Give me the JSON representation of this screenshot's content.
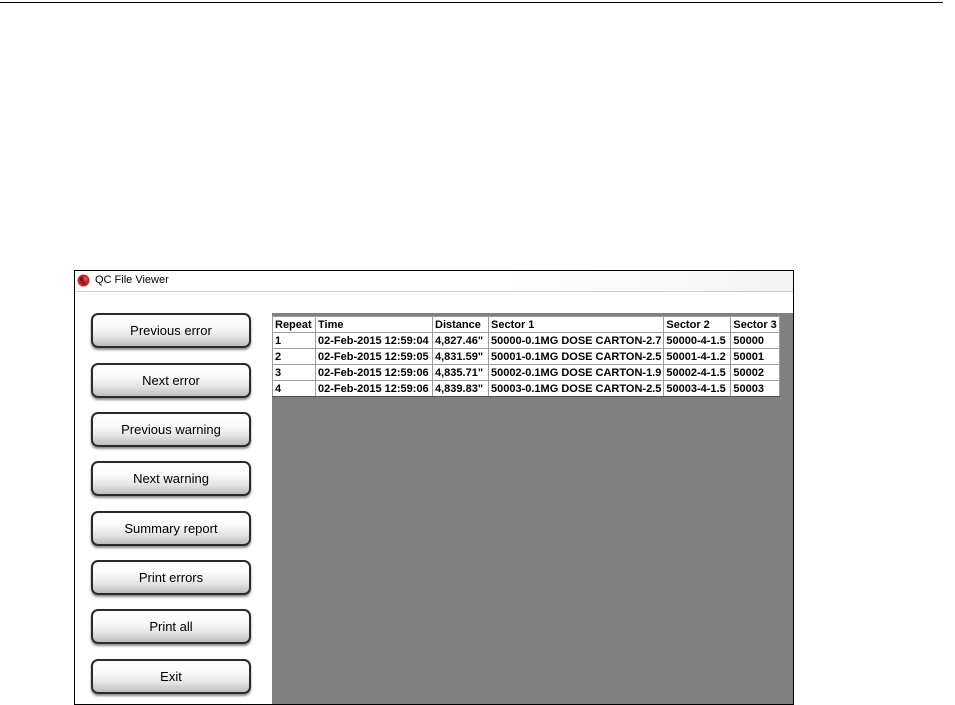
{
  "window": {
    "title": "QC File Viewer",
    "icon": "app-logo-icon"
  },
  "sidebar": {
    "buttons": [
      {
        "label": "Previous error"
      },
      {
        "label": "Next error"
      },
      {
        "label": "Previous warning"
      },
      {
        "label": "Next warning"
      },
      {
        "label": "Summary report"
      },
      {
        "label": "Print errors"
      },
      {
        "label": "Print all"
      },
      {
        "label": "Exit"
      }
    ]
  },
  "table": {
    "columns": [
      "Repeat",
      "Time",
      "Distance",
      "Sector 1",
      "Sector 2",
      "Sector 3"
    ],
    "rows": [
      [
        "1",
        "02-Feb-2015 12:59:04",
        "4,827.46\"",
        "50000-0.1MG DOSE CARTON-2.7",
        "50000-4-1.5",
        "50000"
      ],
      [
        "2",
        "02-Feb-2015 12:59:05",
        "4,831.59\"",
        "50001-0.1MG DOSE CARTON-2.5",
        "50001-4-1.2",
        "50001"
      ],
      [
        "3",
        "02-Feb-2015 12:59:06",
        "4,835.71\"",
        "50002-0.1MG DOSE CARTON-1.9",
        "50002-4-1.5",
        "50002"
      ],
      [
        "4",
        "02-Feb-2015 12:59:06",
        "4,839.83\"",
        "50003-0.1MG DOSE CARTON-2.5",
        "50003-4-1.5",
        "50003"
      ]
    ]
  },
  "colors": {
    "grid_background": "#808080",
    "button_border": "#2a2a2a",
    "icon_red": "#c0282d"
  }
}
